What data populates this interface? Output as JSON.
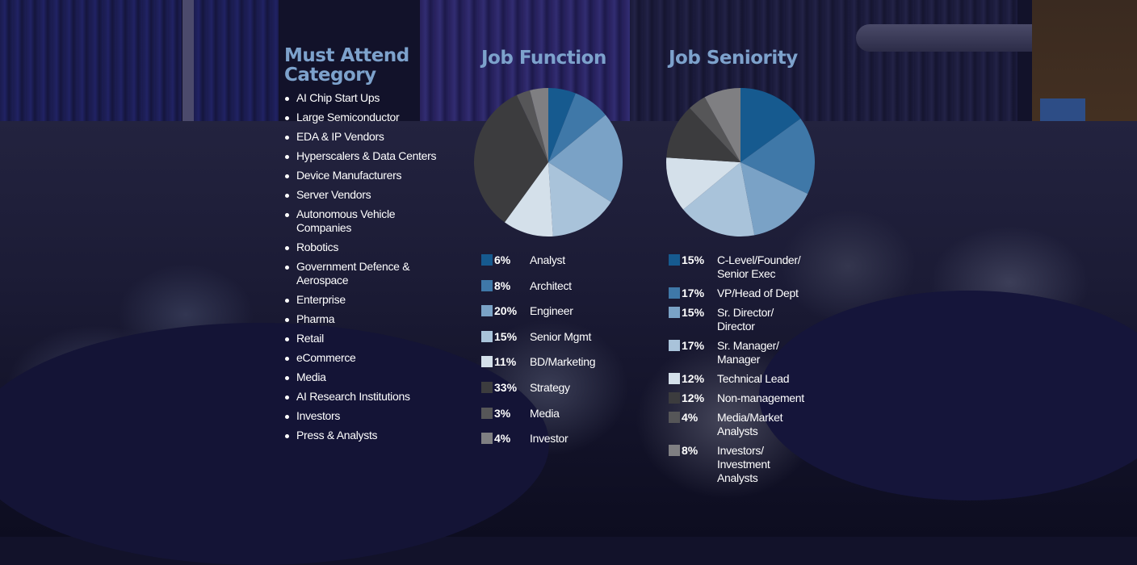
{
  "must_attend": {
    "title_line1": "Must Attend",
    "title_line2": "Category",
    "items": [
      "AI Chip Start Ups",
      "Large Semiconductor",
      "EDA & IP Vendors",
      "Hyperscalers & Data Centers",
      "Device Manufacturers",
      "Server Vendors",
      "Autonomous Vehicle Companies",
      "Robotics",
      "Government Defence & Aerospace",
      "Enterprise",
      "Pharma",
      "Retail",
      "eCommerce",
      "Media",
      "AI Research Institutions",
      "Investors",
      "Press & Analysts"
    ]
  },
  "colors": {
    "title": "#7da2cc",
    "blue1": "#165a8f",
    "blue2": "#3f78a8",
    "blue3": "#7aa2c6",
    "blue4": "#a9c3da",
    "blue5": "#d4e0ea",
    "gray1": "#3c3c3e",
    "gray2": "#565658",
    "gray3": "#7f7f82"
  },
  "chart_data": [
    {
      "type": "pie",
      "title": "Job Function",
      "start": "top",
      "direction": "clockwise",
      "slices": [
        {
          "label": "Analyst",
          "pct_label": "6%",
          "value": 6,
          "color": "#165a8f"
        },
        {
          "label": "Architect",
          "pct_label": "8%",
          "value": 8,
          "color": "#3f78a8"
        },
        {
          "label": "Engineer",
          "pct_label": "20%",
          "value": 20,
          "color": "#7aa2c6"
        },
        {
          "label": "Senior Mgmt",
          "pct_label": "15%",
          "value": 15,
          "color": "#a9c3da"
        },
        {
          "label": "BD/Marketing",
          "pct_label": "11%",
          "value": 11,
          "color": "#d4e0ea"
        },
        {
          "label": "Strategy",
          "pct_label": "33%",
          "value": 33,
          "color": "#3c3c3e"
        },
        {
          "label": "Media",
          "pct_label": "3%",
          "value": 3,
          "color": "#565658"
        },
        {
          "label": "Investor",
          "pct_label": "4%",
          "value": 4,
          "color": "#7f7f82"
        }
      ]
    },
    {
      "type": "pie",
      "title": "Job Seniority",
      "start": "top",
      "direction": "clockwise",
      "slices": [
        {
          "label": "C-Level/Founder/ Senior Exec",
          "pct_label": "15%",
          "value": 15,
          "color": "#165a8f"
        },
        {
          "label": "VP/Head of Dept",
          "pct_label": "17%",
          "value": 17,
          "color": "#3f78a8"
        },
        {
          "label": "Sr. Director/ Director",
          "pct_label": "15%",
          "value": 15,
          "color": "#7aa2c6"
        },
        {
          "label": "Sr. Manager/ Manager",
          "pct_label": "17%",
          "value": 17,
          "color": "#a9c3da"
        },
        {
          "label": "Technical Lead",
          "pct_label": "12%",
          "value": 12,
          "color": "#d4e0ea"
        },
        {
          "label": "Non-management",
          "pct_label": "12%",
          "value": 12,
          "color": "#3c3c3e"
        },
        {
          "label": "Media/Market Analysts",
          "pct_label": "4%",
          "value": 4,
          "color": "#565658"
        },
        {
          "label": "Investors/ Investment Analysts",
          "pct_label": "8%",
          "value": 8,
          "color": "#7f7f82"
        }
      ]
    }
  ]
}
